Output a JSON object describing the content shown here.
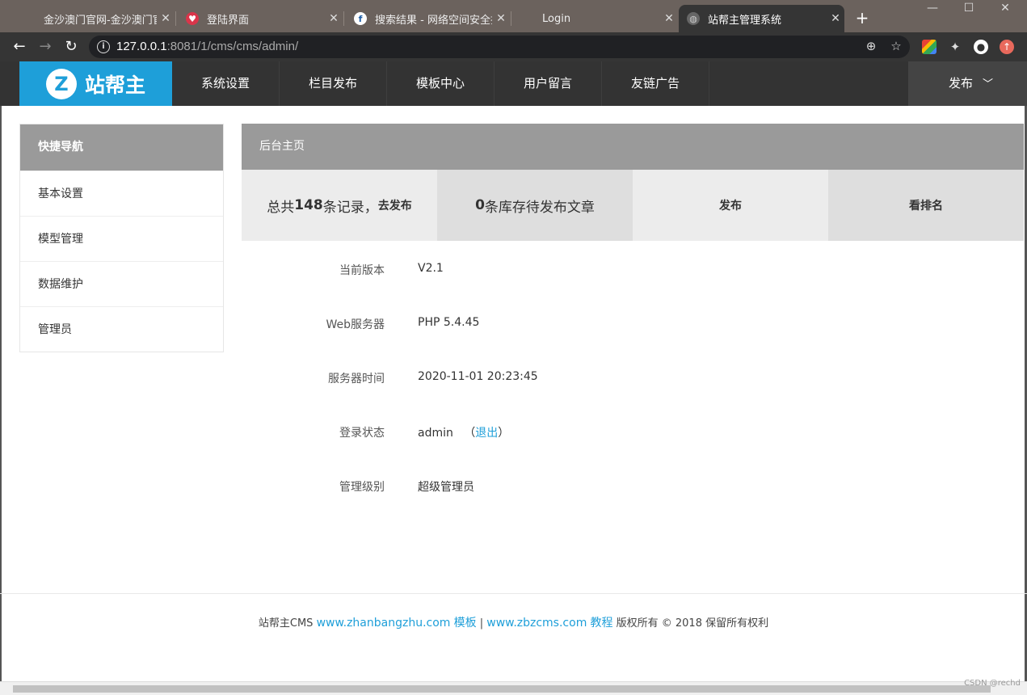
{
  "browser": {
    "tabs": [
      {
        "title": "金沙澳门官网-金沙澳门官",
        "favicon": "blank-icon"
      },
      {
        "title": "登陆界面",
        "favicon": "heart-icon"
      },
      {
        "title": "搜索结果 - 网络空间安全搜",
        "favicon": "search-engine-icon"
      },
      {
        "title": "Login",
        "favicon": "blank-icon"
      },
      {
        "title": "站帮主管理系统",
        "favicon": "globe-icon"
      }
    ],
    "url_host": "127.0.0.1",
    "url_rest": ":8081/1/cms/cms/admin/"
  },
  "header": {
    "logo_letter": "Z",
    "logo_text": "站帮主",
    "nav": [
      "系统设置",
      "栏目发布",
      "模板中心",
      "用户留言",
      "友链广告"
    ],
    "publish_label": "发布"
  },
  "sidebar": {
    "title": "快捷导航",
    "items": [
      "基本设置",
      "模型管理",
      "数据维护",
      "管理员"
    ]
  },
  "main": {
    "title": "后台主页",
    "stats": {
      "total_prefix": "总共",
      "total_count": "148",
      "total_suffix": "条记录，",
      "total_link": "去发布",
      "pending_count": "0",
      "pending_text": "条库存待发布文章",
      "publish": "发布",
      "ranking": "看排名"
    },
    "info": [
      {
        "label": "当前版本",
        "value": "V2.1"
      },
      {
        "label": "Web服务器",
        "value": "PHP 5.4.45"
      },
      {
        "label": "服务器时间",
        "value": "2020-11-01 20:23:45"
      },
      {
        "label": "登录状态",
        "value": "admin"
      },
      {
        "label": "管理级别",
        "value": "超级管理员"
      }
    ],
    "logout_open": "（",
    "logout": "退出",
    "logout_close": "）"
  },
  "footer": {
    "brand": "站帮主CMS",
    "site1": "www.zhanbangzhu.com",
    "link1": "模板",
    "sep": "|",
    "site2": "www.zbzcms.com",
    "link2": "教程",
    "copyright": "版权所有 © 2018 保留所有权利"
  },
  "watermark": "CSDN @rechd",
  "colors": {
    "accent": "#1e9fd9",
    "header": "#333333",
    "panel_head": "#9a9a9a"
  }
}
